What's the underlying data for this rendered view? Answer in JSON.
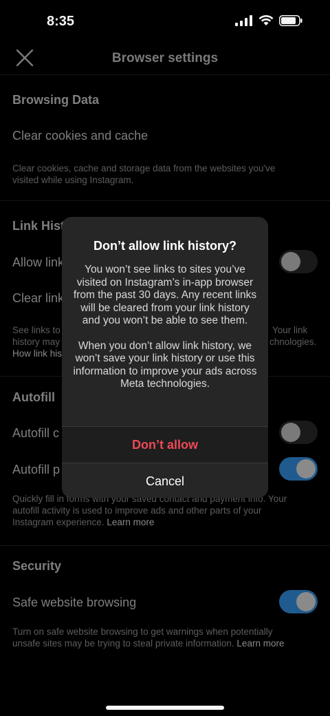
{
  "status_bar": {
    "time": "8:35"
  },
  "header": {
    "title": "Browser settings"
  },
  "browsing_data": {
    "title": "Browsing Data",
    "clear_label": "Clear cookies and cache",
    "desc_line1": "Clear cookies, cache and storage data from the websites you've",
    "desc_line2": "visited while using Instagram."
  },
  "link_history": {
    "title": "Link Hist",
    "allow_label": "Allow link",
    "clear_label": "Clear link",
    "desc_a1": "See links to",
    "desc_a2": "history may",
    "desc_b1": "Your link",
    "desc_b2": "chnologies.",
    "desc_link": "How link his"
  },
  "autofill": {
    "title": "Autofill",
    "contact_label": "Autofill c",
    "payment_label": "Autofill p",
    "desc_line1": "Quickly fill in forms with your saved contact and payment info. Your",
    "desc_line2": "autofill activity is used to improve ads and other parts of your",
    "desc_line3": "Instagram experience.",
    "learn_more": "Learn more"
  },
  "security": {
    "title": "Security",
    "safe_label": "Safe website browsing",
    "desc_line1": "Turn on safe website browsing to get warnings when potentially",
    "desc_line2": "unsafe sites may be trying to steal private information.",
    "learn_more": "Learn more"
  },
  "dialog": {
    "title": "Don’t allow link history?",
    "body_p1": "You won’t see links to sites you’ve visited on Instagram’s in-app browser from the past 30 days. Any recent links will be cleared from your link history and you won’t be able to see them.",
    "body_p2": "When you don’t allow link history, we won’t save your link history or use this information to improve your ads across Meta technologies.",
    "confirm_label": "Don’t allow",
    "cancel_label": "Cancel"
  },
  "toggles": {
    "allow_link_history": false,
    "autofill_contact": false,
    "autofill_payment": true,
    "safe_browsing": true
  },
  "colors": {
    "accent": "#1f5b8e",
    "danger": "#ed4956",
    "dialog_bg": "#262626"
  }
}
